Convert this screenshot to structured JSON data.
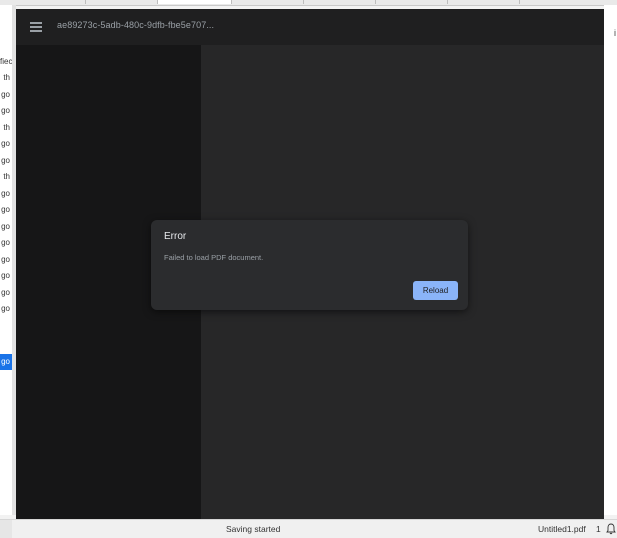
{
  "viewer": {
    "document_title": "ae89273c-5adb-480c-9dfb-fbe5e707...",
    "menu_icon": "hamburger-menu-icon"
  },
  "dialog": {
    "title": "Error",
    "message": "Failed to load PDF document.",
    "reload_label": "Reload"
  },
  "status_bar": {
    "status_text": "Saving started",
    "file_name": "Untitled1.pdf",
    "page_count": "1",
    "notification_icon": "bell-icon"
  },
  "background_sheet": {
    "column_cells": [
      "fiec",
      "th",
      "go",
      "go",
      "th",
      "go",
      "go",
      "th",
      "go",
      "go",
      "go",
      "go",
      "go",
      "go",
      "go",
      "go",
      "go"
    ],
    "selected_row_index": 16,
    "right_edge_text": "i"
  },
  "colors": {
    "viewer_background": "#262627",
    "sidebar_background": "#161617",
    "dialog_background": "#2b2c2e",
    "reload_button": "#8ab4f8",
    "selected_row": "#1a73e8"
  }
}
